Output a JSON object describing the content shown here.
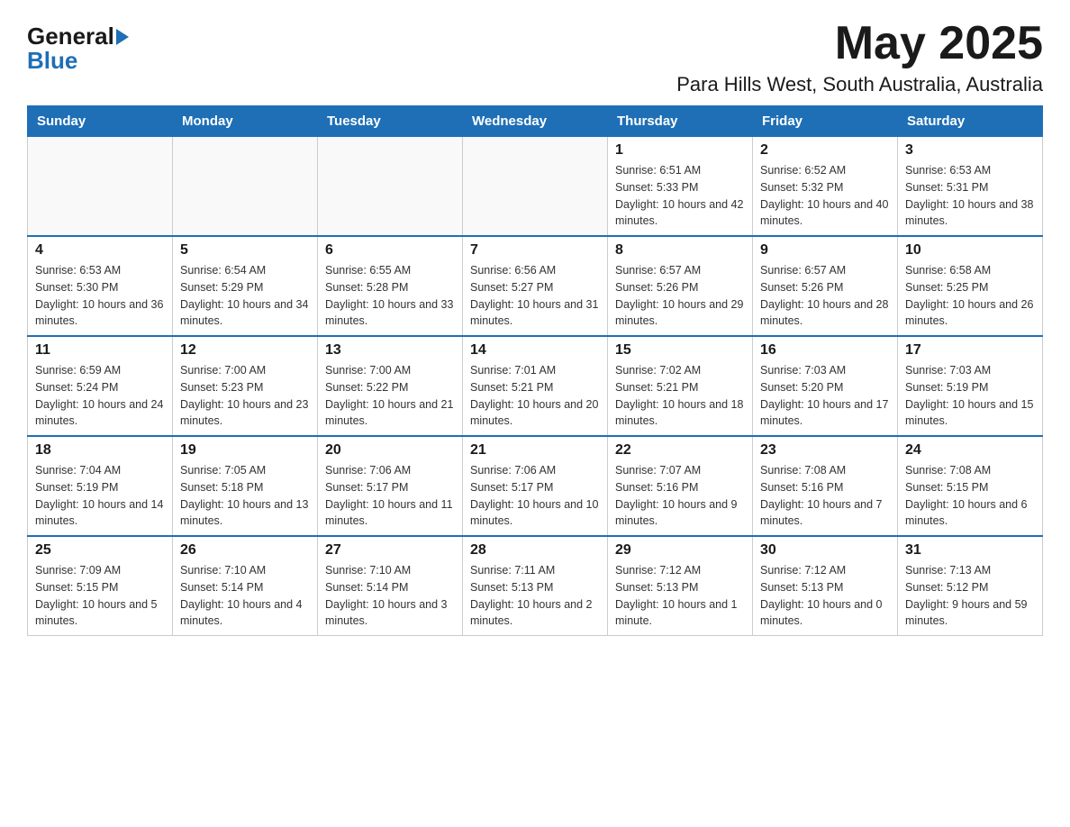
{
  "logo": {
    "general": "General",
    "blue": "Blue"
  },
  "title": {
    "month": "May 2025",
    "location": "Para Hills West, South Australia, Australia"
  },
  "headers": [
    "Sunday",
    "Monday",
    "Tuesday",
    "Wednesday",
    "Thursday",
    "Friday",
    "Saturday"
  ],
  "weeks": [
    [
      {
        "day": "",
        "info": ""
      },
      {
        "day": "",
        "info": ""
      },
      {
        "day": "",
        "info": ""
      },
      {
        "day": "",
        "info": ""
      },
      {
        "day": "1",
        "info": "Sunrise: 6:51 AM\nSunset: 5:33 PM\nDaylight: 10 hours and 42 minutes."
      },
      {
        "day": "2",
        "info": "Sunrise: 6:52 AM\nSunset: 5:32 PM\nDaylight: 10 hours and 40 minutes."
      },
      {
        "day": "3",
        "info": "Sunrise: 6:53 AM\nSunset: 5:31 PM\nDaylight: 10 hours and 38 minutes."
      }
    ],
    [
      {
        "day": "4",
        "info": "Sunrise: 6:53 AM\nSunset: 5:30 PM\nDaylight: 10 hours and 36 minutes."
      },
      {
        "day": "5",
        "info": "Sunrise: 6:54 AM\nSunset: 5:29 PM\nDaylight: 10 hours and 34 minutes."
      },
      {
        "day": "6",
        "info": "Sunrise: 6:55 AM\nSunset: 5:28 PM\nDaylight: 10 hours and 33 minutes."
      },
      {
        "day": "7",
        "info": "Sunrise: 6:56 AM\nSunset: 5:27 PM\nDaylight: 10 hours and 31 minutes."
      },
      {
        "day": "8",
        "info": "Sunrise: 6:57 AM\nSunset: 5:26 PM\nDaylight: 10 hours and 29 minutes."
      },
      {
        "day": "9",
        "info": "Sunrise: 6:57 AM\nSunset: 5:26 PM\nDaylight: 10 hours and 28 minutes."
      },
      {
        "day": "10",
        "info": "Sunrise: 6:58 AM\nSunset: 5:25 PM\nDaylight: 10 hours and 26 minutes."
      }
    ],
    [
      {
        "day": "11",
        "info": "Sunrise: 6:59 AM\nSunset: 5:24 PM\nDaylight: 10 hours and 24 minutes."
      },
      {
        "day": "12",
        "info": "Sunrise: 7:00 AM\nSunset: 5:23 PM\nDaylight: 10 hours and 23 minutes."
      },
      {
        "day": "13",
        "info": "Sunrise: 7:00 AM\nSunset: 5:22 PM\nDaylight: 10 hours and 21 minutes."
      },
      {
        "day": "14",
        "info": "Sunrise: 7:01 AM\nSunset: 5:21 PM\nDaylight: 10 hours and 20 minutes."
      },
      {
        "day": "15",
        "info": "Sunrise: 7:02 AM\nSunset: 5:21 PM\nDaylight: 10 hours and 18 minutes."
      },
      {
        "day": "16",
        "info": "Sunrise: 7:03 AM\nSunset: 5:20 PM\nDaylight: 10 hours and 17 minutes."
      },
      {
        "day": "17",
        "info": "Sunrise: 7:03 AM\nSunset: 5:19 PM\nDaylight: 10 hours and 15 minutes."
      }
    ],
    [
      {
        "day": "18",
        "info": "Sunrise: 7:04 AM\nSunset: 5:19 PM\nDaylight: 10 hours and 14 minutes."
      },
      {
        "day": "19",
        "info": "Sunrise: 7:05 AM\nSunset: 5:18 PM\nDaylight: 10 hours and 13 minutes."
      },
      {
        "day": "20",
        "info": "Sunrise: 7:06 AM\nSunset: 5:17 PM\nDaylight: 10 hours and 11 minutes."
      },
      {
        "day": "21",
        "info": "Sunrise: 7:06 AM\nSunset: 5:17 PM\nDaylight: 10 hours and 10 minutes."
      },
      {
        "day": "22",
        "info": "Sunrise: 7:07 AM\nSunset: 5:16 PM\nDaylight: 10 hours and 9 minutes."
      },
      {
        "day": "23",
        "info": "Sunrise: 7:08 AM\nSunset: 5:16 PM\nDaylight: 10 hours and 7 minutes."
      },
      {
        "day": "24",
        "info": "Sunrise: 7:08 AM\nSunset: 5:15 PM\nDaylight: 10 hours and 6 minutes."
      }
    ],
    [
      {
        "day": "25",
        "info": "Sunrise: 7:09 AM\nSunset: 5:15 PM\nDaylight: 10 hours and 5 minutes."
      },
      {
        "day": "26",
        "info": "Sunrise: 7:10 AM\nSunset: 5:14 PM\nDaylight: 10 hours and 4 minutes."
      },
      {
        "day": "27",
        "info": "Sunrise: 7:10 AM\nSunset: 5:14 PM\nDaylight: 10 hours and 3 minutes."
      },
      {
        "day": "28",
        "info": "Sunrise: 7:11 AM\nSunset: 5:13 PM\nDaylight: 10 hours and 2 minutes."
      },
      {
        "day": "29",
        "info": "Sunrise: 7:12 AM\nSunset: 5:13 PM\nDaylight: 10 hours and 1 minute."
      },
      {
        "day": "30",
        "info": "Sunrise: 7:12 AM\nSunset: 5:13 PM\nDaylight: 10 hours and 0 minutes."
      },
      {
        "day": "31",
        "info": "Sunrise: 7:13 AM\nSunset: 5:12 PM\nDaylight: 9 hours and 59 minutes."
      }
    ]
  ]
}
